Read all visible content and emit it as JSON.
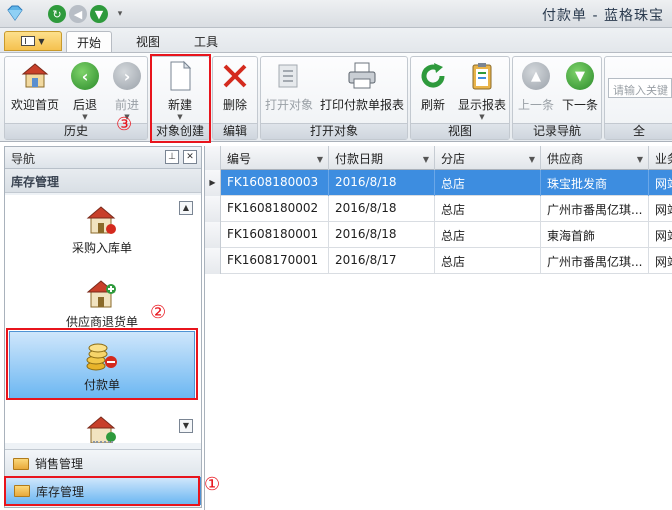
{
  "window": {
    "title": "付款单 - 蓝格珠宝"
  },
  "ribbon": {
    "tabs": [
      {
        "label": "开始",
        "active": true
      },
      {
        "label": "视图",
        "active": false
      },
      {
        "label": "工具",
        "active": false
      }
    ],
    "groups": {
      "history": {
        "caption": "历史",
        "home": "欢迎首页",
        "back": "后退",
        "forward": "前进"
      },
      "create": {
        "caption": "对象创建",
        "new": "新建"
      },
      "edit": {
        "caption": "编辑",
        "delete": "删除"
      },
      "open": {
        "caption": "打开对象",
        "open_obj": "打开对象",
        "print": "打印付款单报表"
      },
      "view": {
        "caption": "视图",
        "refresh": "刷新",
        "show_report": "显示报表"
      },
      "recnav": {
        "caption": "记录导航",
        "prev": "上一条",
        "next": "下一条"
      },
      "search": {
        "caption": "全",
        "placeholder": "请输入关键"
      }
    }
  },
  "annotations": {
    "n1": "①",
    "n2": "②",
    "n3": "③"
  },
  "nav": {
    "title": "导航",
    "section": "库存管理",
    "items": [
      {
        "label": "采购入库单"
      },
      {
        "label": "供应商退货单"
      },
      {
        "label": "付款单"
      }
    ],
    "categories": [
      {
        "label": "销售管理"
      },
      {
        "label": "库存管理"
      }
    ]
  },
  "grid": {
    "headers": [
      "编号",
      "付款日期",
      "分店",
      "供应商",
      "业务"
    ],
    "rows": [
      [
        "FK1608180003",
        "2016/8/18",
        "总店",
        "珠宝批发商",
        "网站"
      ],
      [
        "FK1608180002",
        "2016/8/18",
        "总店",
        "广州市番禺亿琪...",
        "网站"
      ],
      [
        "FK1608180001",
        "2016/8/18",
        "总店",
        "東海首飾",
        "网站"
      ],
      [
        "FK1608170001",
        "2016/8/17",
        "总店",
        "广州市番禺亿琪...",
        "网站"
      ]
    ]
  },
  "colors": {
    "accent": "#3d8de0",
    "highlight": "#e8141c",
    "selected_nav": "#6cb7f2"
  }
}
